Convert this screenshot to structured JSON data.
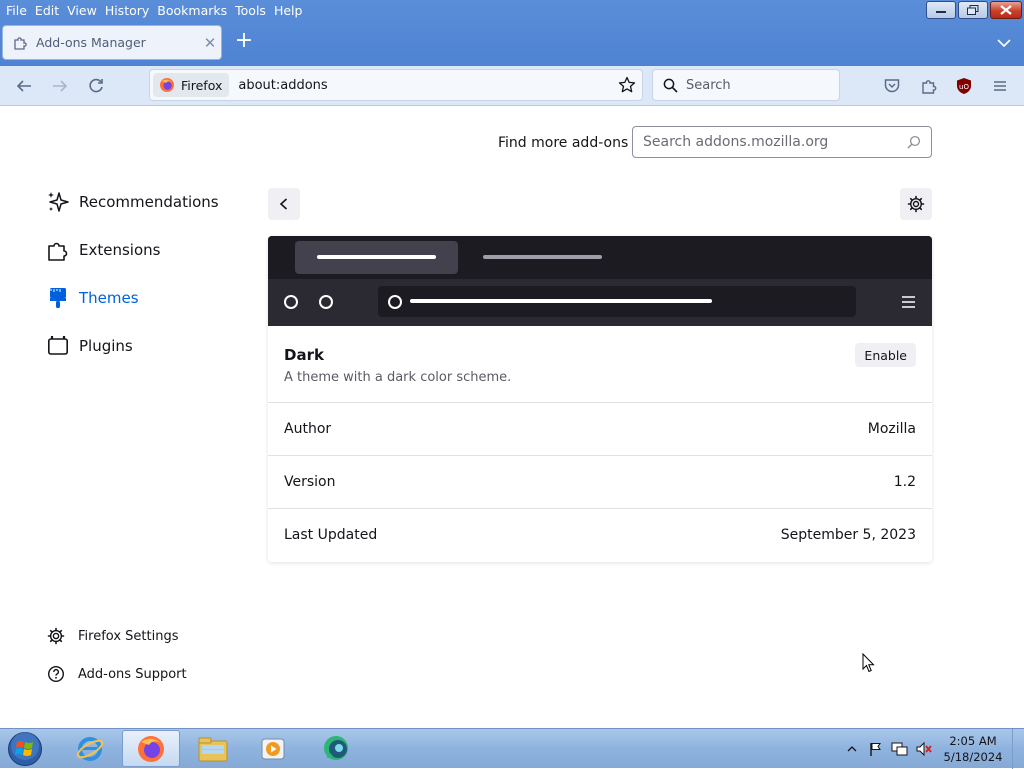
{
  "menubar": {
    "items": [
      "File",
      "Edit",
      "View",
      "History",
      "Bookmarks",
      "Tools",
      "Help"
    ],
    "underline": [
      "F",
      "E",
      "V",
      "H",
      "B",
      "T",
      "H"
    ]
  },
  "tab": {
    "title": "Add-ons Manager",
    "icon": "puzzle-icon"
  },
  "navbar": {
    "identity_label": "Firefox",
    "url": "about:addons",
    "search_placeholder": "Search"
  },
  "addons": {
    "find_more_label": "Find more add-ons",
    "amo_search_placeholder": "Search addons.mozilla.org",
    "categories": [
      {
        "label": "Recommendations",
        "icon": "sparkle-icon",
        "active": false
      },
      {
        "label": "Extensions",
        "icon": "puzzle-icon",
        "active": false
      },
      {
        "label": "Themes",
        "icon": "paintbrush-icon",
        "active": true
      },
      {
        "label": "Plugins",
        "icon": "plugin-icon",
        "active": false
      }
    ],
    "footer": [
      {
        "label": "Firefox Settings",
        "icon": "gear-icon"
      },
      {
        "label": "Add-ons Support",
        "icon": "help-icon"
      }
    ]
  },
  "theme": {
    "name": "Dark",
    "description": "A theme with a dark color scheme.",
    "enable_label": "Enable",
    "details": [
      {
        "label": "Author",
        "value": "Mozilla"
      },
      {
        "label": "Version",
        "value": "1.2"
      },
      {
        "label": "Last Updated",
        "value": "September 5, 2023"
      }
    ]
  },
  "taskbar": {
    "apps": [
      "internet-explorer-icon",
      "firefox-icon",
      "file-explorer-icon",
      "media-player-icon",
      "chat-app-icon"
    ],
    "active_app": "firefox-icon",
    "clock_time": "2:05 AM",
    "clock_date": "5/18/2024"
  },
  "colors": {
    "accent": "#0061e0",
    "titlebar": "#4e83d3",
    "toolbar": "#dce8f8",
    "preview_dark": "#1c1b22",
    "preview_toolbar": "#2b2a33"
  }
}
